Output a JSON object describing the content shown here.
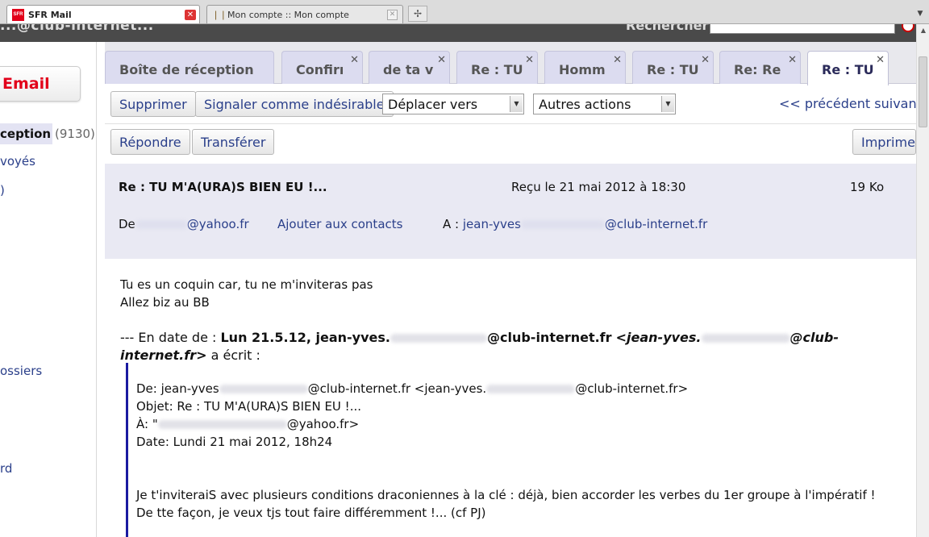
{
  "browser": {
    "tabs": [
      {
        "title": "SFR Mail"
      },
      {
        "title": "Mon compte :: Mon compte"
      }
    ],
    "favicon_text": "SFR"
  },
  "header": {
    "account_email_partial": "...@club-internet...",
    "search_label": "Rechercher"
  },
  "sidebar": {
    "compose_label": "Email",
    "folders": [
      {
        "label": "ception",
        "count": "(9130)"
      },
      {
        "label": "voyés"
      },
      {
        "label": ")"
      },
      {
        "label": "ossiers"
      },
      {
        "label": "rd"
      }
    ]
  },
  "mail_tabs": [
    {
      "label": "Boîte de réception",
      "closable": false
    },
    {
      "label": "Confirı",
      "closable": true
    },
    {
      "label": "de ta v",
      "closable": true
    },
    {
      "label": "Re : TU",
      "closable": true
    },
    {
      "label": "Homm",
      "closable": true
    },
    {
      "label": "Re : TU",
      "closable": true
    },
    {
      "label": "Re: Re",
      "closable": true
    },
    {
      "label": "Re : TU",
      "closable": true,
      "active": true
    }
  ],
  "toolbar": {
    "delete_label": "Supprimer",
    "spam_label": "Signaler comme indésirable",
    "move_select": "Déplacer vers",
    "actions_select": "Autres actions",
    "prev_label": "<< précédent",
    "next_label": "suivant",
    "reply_label": "Répondre",
    "forward_label": "Transférer",
    "print_label": "Imprimer"
  },
  "message": {
    "subject": "Re : TU M'A(URA)S BIEN EU !...",
    "received": "Reçu le 21 mai 2012 à 18:30",
    "size": "19 Ko",
    "from_label": "De",
    "from_domain": "@yahoo.fr",
    "add_contact_label": "Ajouter aux contacts",
    "to_label": "A :",
    "to_prefix": "jean-yves",
    "to_domain": "@club-internet.fr",
    "body_line1": "Tu es un coquin car, tu ne m'inviteras pas",
    "body_line2": "Allez biz au BB",
    "reply_intro_prefix": "--- En date de :",
    "reply_intro_date": "Lun 21.5.12, jean-yves.",
    "reply_intro_domain": "@club-internet.fr",
    "reply_intro_addr_a": "<jean-yves.",
    "reply_intro_addr_b": "@club-",
    "reply_intro_addr_c": "internet.fr>",
    "reply_intro_suffix": "a écrit :",
    "quote_from_a": "De: jean-yves",
    "quote_from_b": "@club-internet.fr <jean-yves.",
    "quote_from_c": "@club-internet.fr>",
    "quote_subject": "Objet: Re : TU M'A(URA)S BIEN EU !...",
    "quote_to_a": "À: \"",
    "quote_to_b": "@yahoo.fr>",
    "quote_date": "Date: Lundi 21 mai 2012, 18h24",
    "quote_body1": "Je t'inviteraiS avec plusieurs conditions draconiennes à la clé : déjà, bien accorder les verbes du 1er groupe à l'impératif !",
    "quote_body2": "De tte façon, je veux tjs tout faire différemment !...  (cf PJ)"
  },
  "colors": {
    "brand_red": "#e2001a",
    "link_blue": "#2a3f8a",
    "header_bg": "#e9e9f3",
    "quote_bar": "#1a1aa0"
  }
}
